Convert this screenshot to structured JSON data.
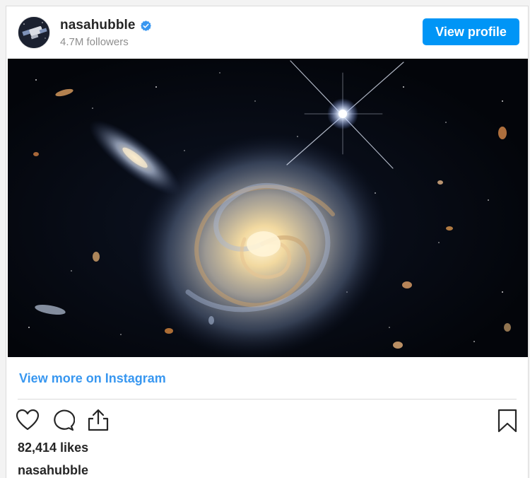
{
  "post": {
    "username": "nasahubble",
    "followers": "4.7M followers",
    "verified": true,
    "view_profile_label": "View profile",
    "view_more_label": "View more on Instagram",
    "likes": "82,414 likes",
    "caption_username": "nasahubble",
    "photo_subject": "spiral galaxy with companion galaxy and bright star"
  },
  "icons": {
    "verified": "verified-badge-icon",
    "like": "heart-icon",
    "comment": "comment-bubble-icon",
    "share": "share-upload-icon",
    "save": "bookmark-icon"
  },
  "colors": {
    "accent": "#0095f6",
    "link": "#3897f0",
    "text": "#262626",
    "muted": "#8e8e8e",
    "border": "#dbdbdb"
  }
}
